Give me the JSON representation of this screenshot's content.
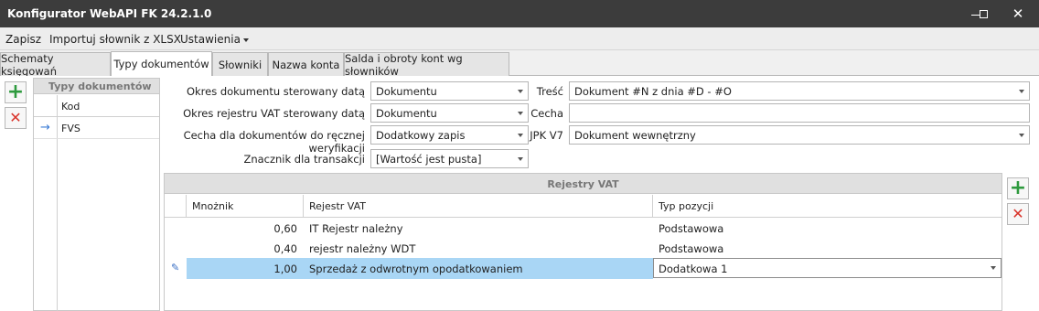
{
  "window": {
    "title": "Konfigurator WebAPI FK 24.2.1.0"
  },
  "menu": {
    "save": "Zapisz",
    "import": "Importuj słownik z XLSX",
    "settings": "Ustawienia"
  },
  "tabs": [
    {
      "label": "Schematy księgowań",
      "active": false
    },
    {
      "label": "Typy dokumentów",
      "active": true
    },
    {
      "label": "Słowniki",
      "active": false
    },
    {
      "label": "Nazwa konta",
      "active": false
    },
    {
      "label": "Salda i obroty kont wg słowników",
      "active": false
    }
  ],
  "doctypes": {
    "header": "Typy dokumentów",
    "col_code": "Kod",
    "rows": [
      {
        "code": "FVS",
        "current": true
      }
    ]
  },
  "form": {
    "okres_dok": {
      "label": "Okres dokumentu sterowany datą",
      "value": "Dokumentu"
    },
    "okres_vat": {
      "label": "Okres rejestru VAT sterowany datą",
      "value": "Dokumentu"
    },
    "cecha_wer": {
      "label": "Cecha dla dokumentów do ręcznej weryfikacji",
      "value": "Dodatkowy zapis"
    },
    "znacznik": {
      "label": "Znacznik dla transakcji",
      "value": "[Wartość jest pusta]"
    },
    "tresc": {
      "label": "Treść",
      "value": "Dokument #N z dnia #D - #O"
    },
    "cecha": {
      "label": "Cecha",
      "value": ""
    },
    "jpk": {
      "label": "JPK V7",
      "value": "Dokument wewnętrzny"
    }
  },
  "vat": {
    "header": "Rejestry VAT",
    "columns": {
      "mnoznik": "Mnożnik",
      "rejestr": "Rejestr VAT",
      "typ": "Typ pozycji"
    },
    "rows": [
      {
        "mnoznik": "0,60",
        "rejestr": "IT Rejestr należny",
        "typ": "Podstawowa",
        "editing": false
      },
      {
        "mnoznik": "0,40",
        "rejestr": "rejestr należny WDT",
        "typ": "Podstawowa",
        "editing": false
      },
      {
        "mnoznik": "1,00",
        "rejestr": "Sprzedaż z odwrotnym opodatkowaniem",
        "typ": "Dodatkowa 1",
        "editing": true
      }
    ]
  },
  "icons": {
    "add": "plus-icon",
    "remove": "cross-icon",
    "current_row": "arrow-right-icon",
    "edit_row": "pencil-icon"
  },
  "colors": {
    "add": "#2e9a3e",
    "remove": "#d9332a",
    "selection": "#a9d6f5",
    "titlebar": "#3c3c3c"
  }
}
